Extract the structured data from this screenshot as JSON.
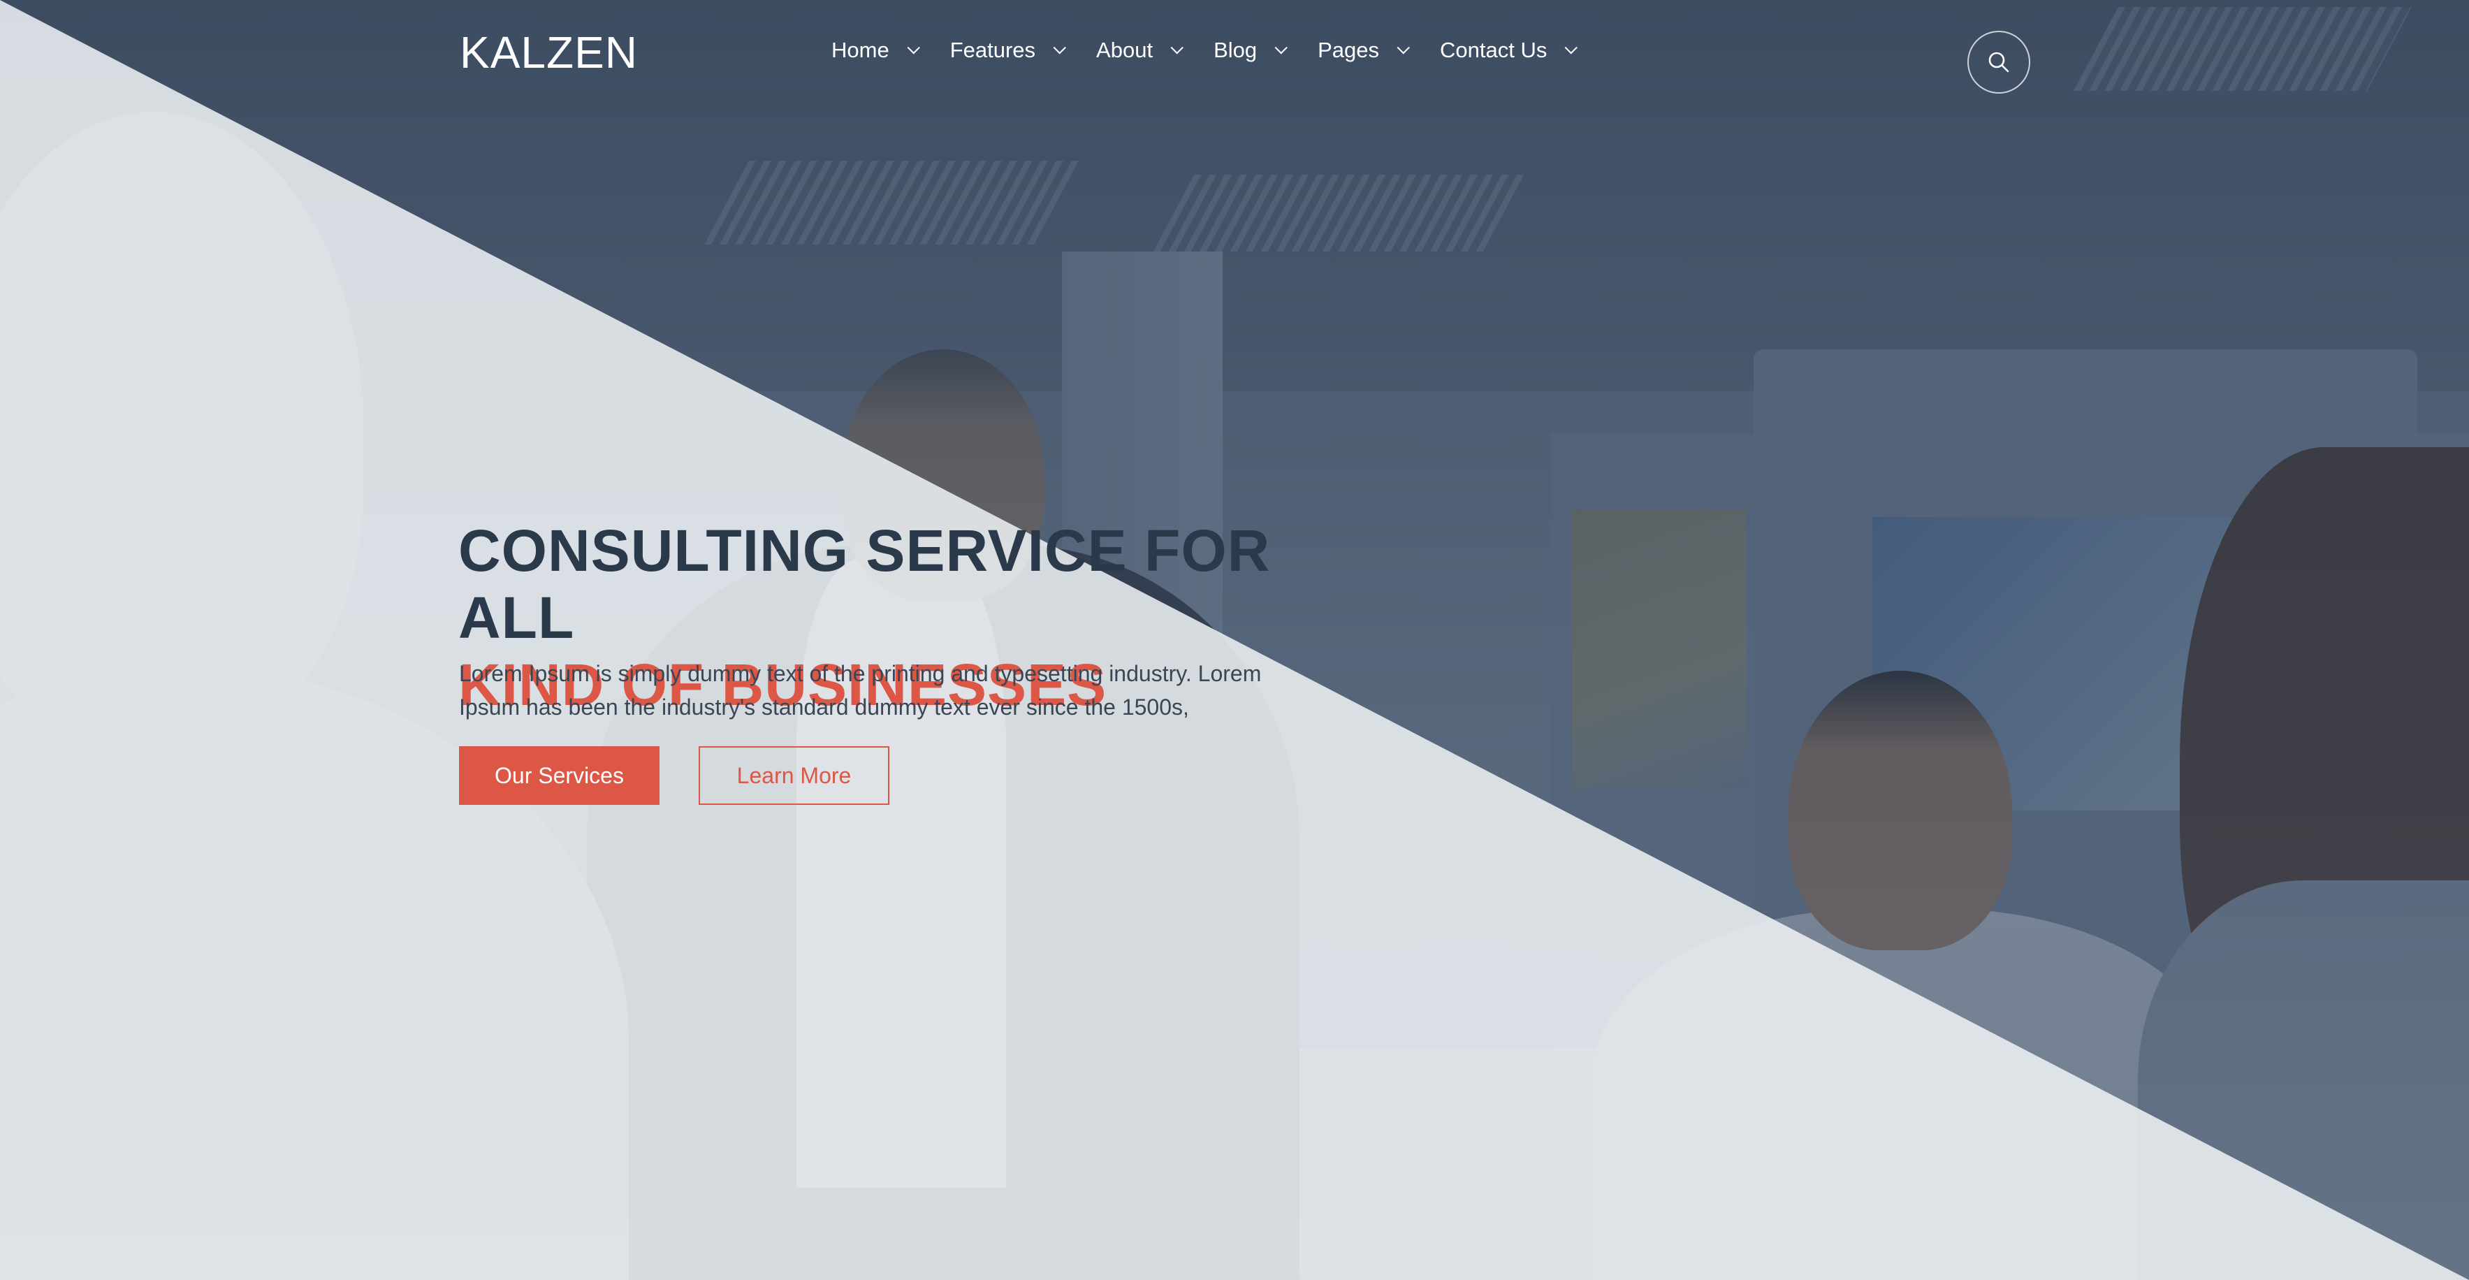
{
  "brand": {
    "logo_text": "KALZEN"
  },
  "nav": {
    "items": [
      {
        "label": "Home"
      },
      {
        "label": "Features"
      },
      {
        "label": "About"
      },
      {
        "label": "Blog"
      },
      {
        "label": "Pages"
      },
      {
        "label": "Contact Us"
      }
    ]
  },
  "hero": {
    "title_line1": "CONSULTING SERVICE FOR ALL",
    "title_line2": "KIND OF BUSINESSES",
    "description": "Lorem Ipsum is simply dummy text of the printing and typesetting industry. Lorem Ipsum has been the industry's standard dummy text ever since the 1500s,",
    "primary_button": "Our Services",
    "secondary_button": "Learn More"
  },
  "icons": {
    "search": "search-icon",
    "dropdown": "chevron-down-icon"
  },
  "colors": {
    "accent": "#dc5745",
    "heading": "#2b3a4b",
    "overlay": "#2d3c52"
  }
}
